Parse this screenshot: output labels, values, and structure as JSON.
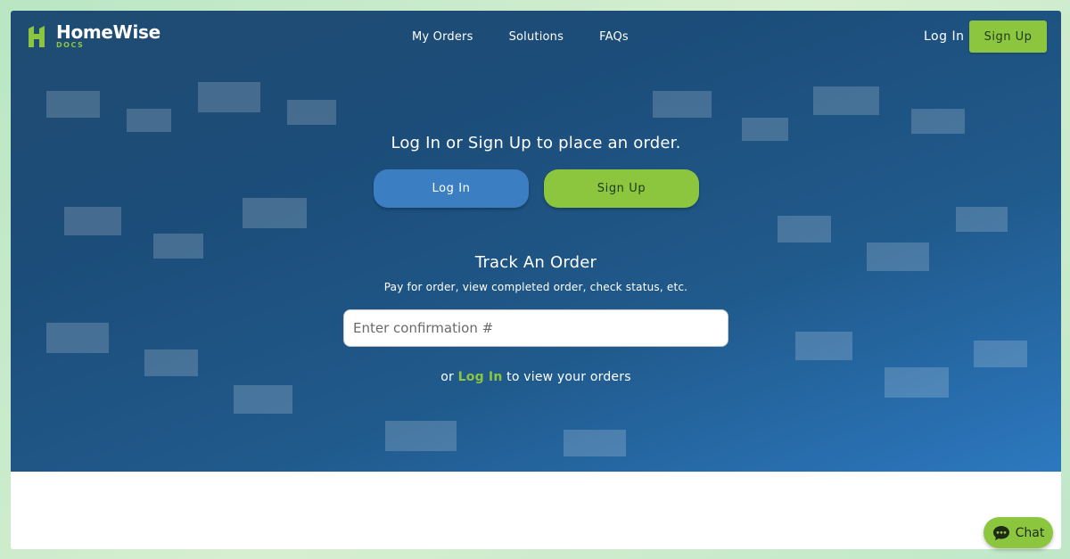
{
  "brand": {
    "name": "HomeWise",
    "sub": "DOCS",
    "accent_green": "#8cc63f",
    "accent_blue": "#3c7ec2"
  },
  "nav": {
    "items": [
      {
        "label": "My Orders"
      },
      {
        "label": "Solutions"
      },
      {
        "label": "FAQs"
      }
    ],
    "login_label": "Log In",
    "signup_label": "Sign Up"
  },
  "hero": {
    "prompt": "Log In or Sign Up to place an order.",
    "login_button": "Log In",
    "signup_button": "Sign Up"
  },
  "track": {
    "title": "Track An Order",
    "subtitle": "Pay for order, view completed order, check status, etc.",
    "input_placeholder": "Enter confirmation #",
    "input_value": "",
    "or_text": "or",
    "login_link": "Log In",
    "view_text": "to view your orders"
  },
  "chat": {
    "label": "Chat",
    "icon": "chat-bubble-icon"
  }
}
